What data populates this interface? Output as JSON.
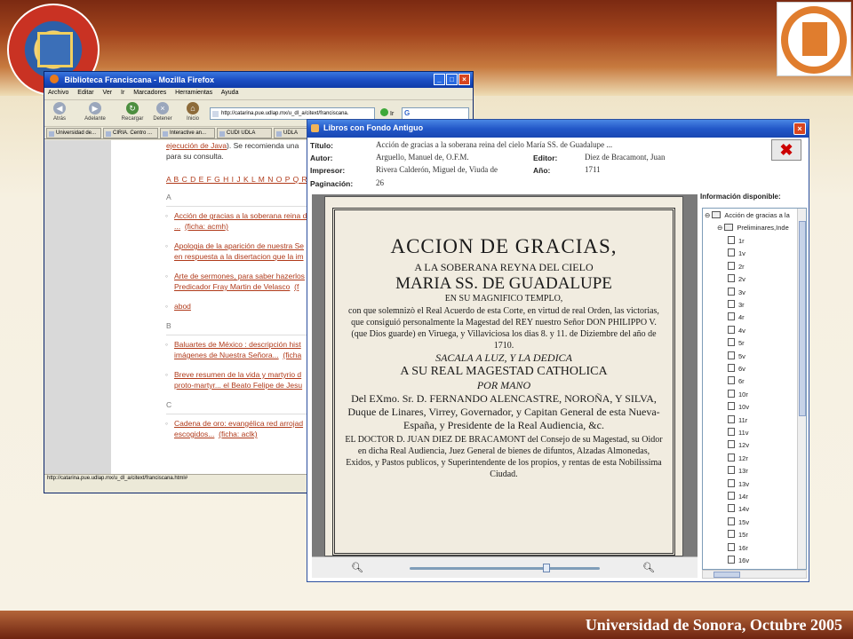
{
  "slide": {
    "footer": "Universidad de Sonora, Octubre 2005"
  },
  "firefox": {
    "title": "Biblioteca Franciscana - Mozilla Firefox",
    "menu": [
      "Archivo",
      "Editar",
      "Ver",
      "Ir",
      "Marcadores",
      "Herramientas",
      "Ayuda"
    ],
    "toolbar": {
      "back": "Atrás",
      "forward": "Adelante",
      "reload": "Recargar",
      "stop": "Detener",
      "home": "Inicio",
      "go": "Ir"
    },
    "url": "http://catarina.pue.udlap.mx/u_dl_a/citext/franciscana.",
    "tabs": [
      "Universidad de...",
      "CIRIA. Centro ...",
      "Interactive an...",
      "CUDI UDLA",
      "UDLA"
    ],
    "page": {
      "intro_link": "ejecución de Java",
      "intro_text": "). Se recomienda una",
      "intro_text2": "para su consulta.",
      "alphabet": "A B C D E F G H I J K L M N O P Q R",
      "sections": [
        {
          "letter": "A",
          "entries": [
            {
              "line1": "Acción de gracias a la soberana reina d",
              "line2": "...",
              "ficha": "(ficha: acmh)"
            },
            {
              "line1": "Apologia de la aparición de nuestra Se",
              "line2": "en respuesta a la disertacion que la im",
              "ficha": ""
            },
            {
              "line1": "Arte de sermones, para saber hazerlos",
              "line2": "Predicador Fray Martin de Velasco",
              "ficha": "(f"
            },
            {
              "line1": "abod",
              "line2": "",
              "ficha": ""
            }
          ]
        },
        {
          "letter": "B",
          "entries": [
            {
              "line1": "Baluartes de México : descripción hist",
              "line2": "imágenes de Nuestra Señora...",
              "ficha": "(ficha"
            },
            {
              "line1": "Breve resumen de la vida y martyrio d",
              "line2": "proto-martyr... el Beato Felipe de Jesu",
              "ficha": ""
            }
          ]
        },
        {
          "letter": "C",
          "entries": [
            {
              "line1": "Cadena de oro: evangélica red arrojad",
              "line2": "escogidos...",
              "ficha": "(ficha: aclk)"
            }
          ]
        }
      ]
    },
    "status": "http://catarina.pue.udlap.mx/u_dl_a/citext/franciscana.html#"
  },
  "java": {
    "title": "Libros con Fondo Antiguo",
    "fields": {
      "titulo_label": "Título:",
      "titulo": "Acción de gracias a la soberana reina del cielo María SS. de Guadalupe ...",
      "autor_label": "Autor:",
      "autor": "Arguello, Manuel de, O.F.M.",
      "editor_label": "Editor:",
      "editor": "Diez de Bracamont, Juan",
      "impresor_label": "Impresor:",
      "impresor": "Rivera Calderón, Miguel de, Viuda de",
      "anio_label": "Año:",
      "anio": "1711",
      "paginacion_label": "Paginación:",
      "paginacion": "26"
    },
    "page_text": {
      "l1": "ACCION DE GRACIAS,",
      "l2": "A LA SOBERANA REYNA DEL CIELO",
      "l3": "MARIA SS. DE GUADALUPE",
      "l4": "EN SU MAGNIFICO TEMPLO,",
      "body": "con que solemnizò el Real Acuerdo de esta Corte, en virtud de real Orden, las victorias, que consiguió personalmente la Magestad del REY nuestro Señor DON PHILIPPO V. (que Dios guarde) en Viruega, y Villaviciosa los dias 8. y 11. de Diziembre del año de 1710.",
      "l5": "SACALA A LUZ, Y LA DEDICA",
      "l6": "A SU REAL MAGESTAD CATHOLICA",
      "l7": "POR MANO",
      "body2": "Del EXmo. Sr. D. FERNANDO ALENCASTRE, NOROÑA, Y SILVA, Duque de Linares, Virrey, Governador, y Capitan General de esta Nueva-España, y Presidente de la Real Audiencia, &c.",
      "body3": "EL DOCTOR D. JUAN DIEZ DE BRACAMONT del Consejo de su Magestad, su Oidor en dicha Real Audiencia, Juez General de bienes de difuntos, Alzadas Almonedas, Exidos, y Pastos publicos, y Superintendente de los propios, y rentas de esta Nobilissima Ciudad."
    },
    "zoom_level": 0.72,
    "tree": {
      "header": "Información disponible:",
      "root": "Acción de gracias a la",
      "folder": "Preliminares,Inde",
      "pages": [
        "1r",
        "1v",
        "2r",
        "2v",
        "3v",
        "3r",
        "4r",
        "4v",
        "5r",
        "5v",
        "6v",
        "6r",
        "10r",
        "10v",
        "11r",
        "11v",
        "12v",
        "12r",
        "13r",
        "13v",
        "14r",
        "14v",
        "15v",
        "15r",
        "16r",
        "16v"
      ]
    }
  }
}
